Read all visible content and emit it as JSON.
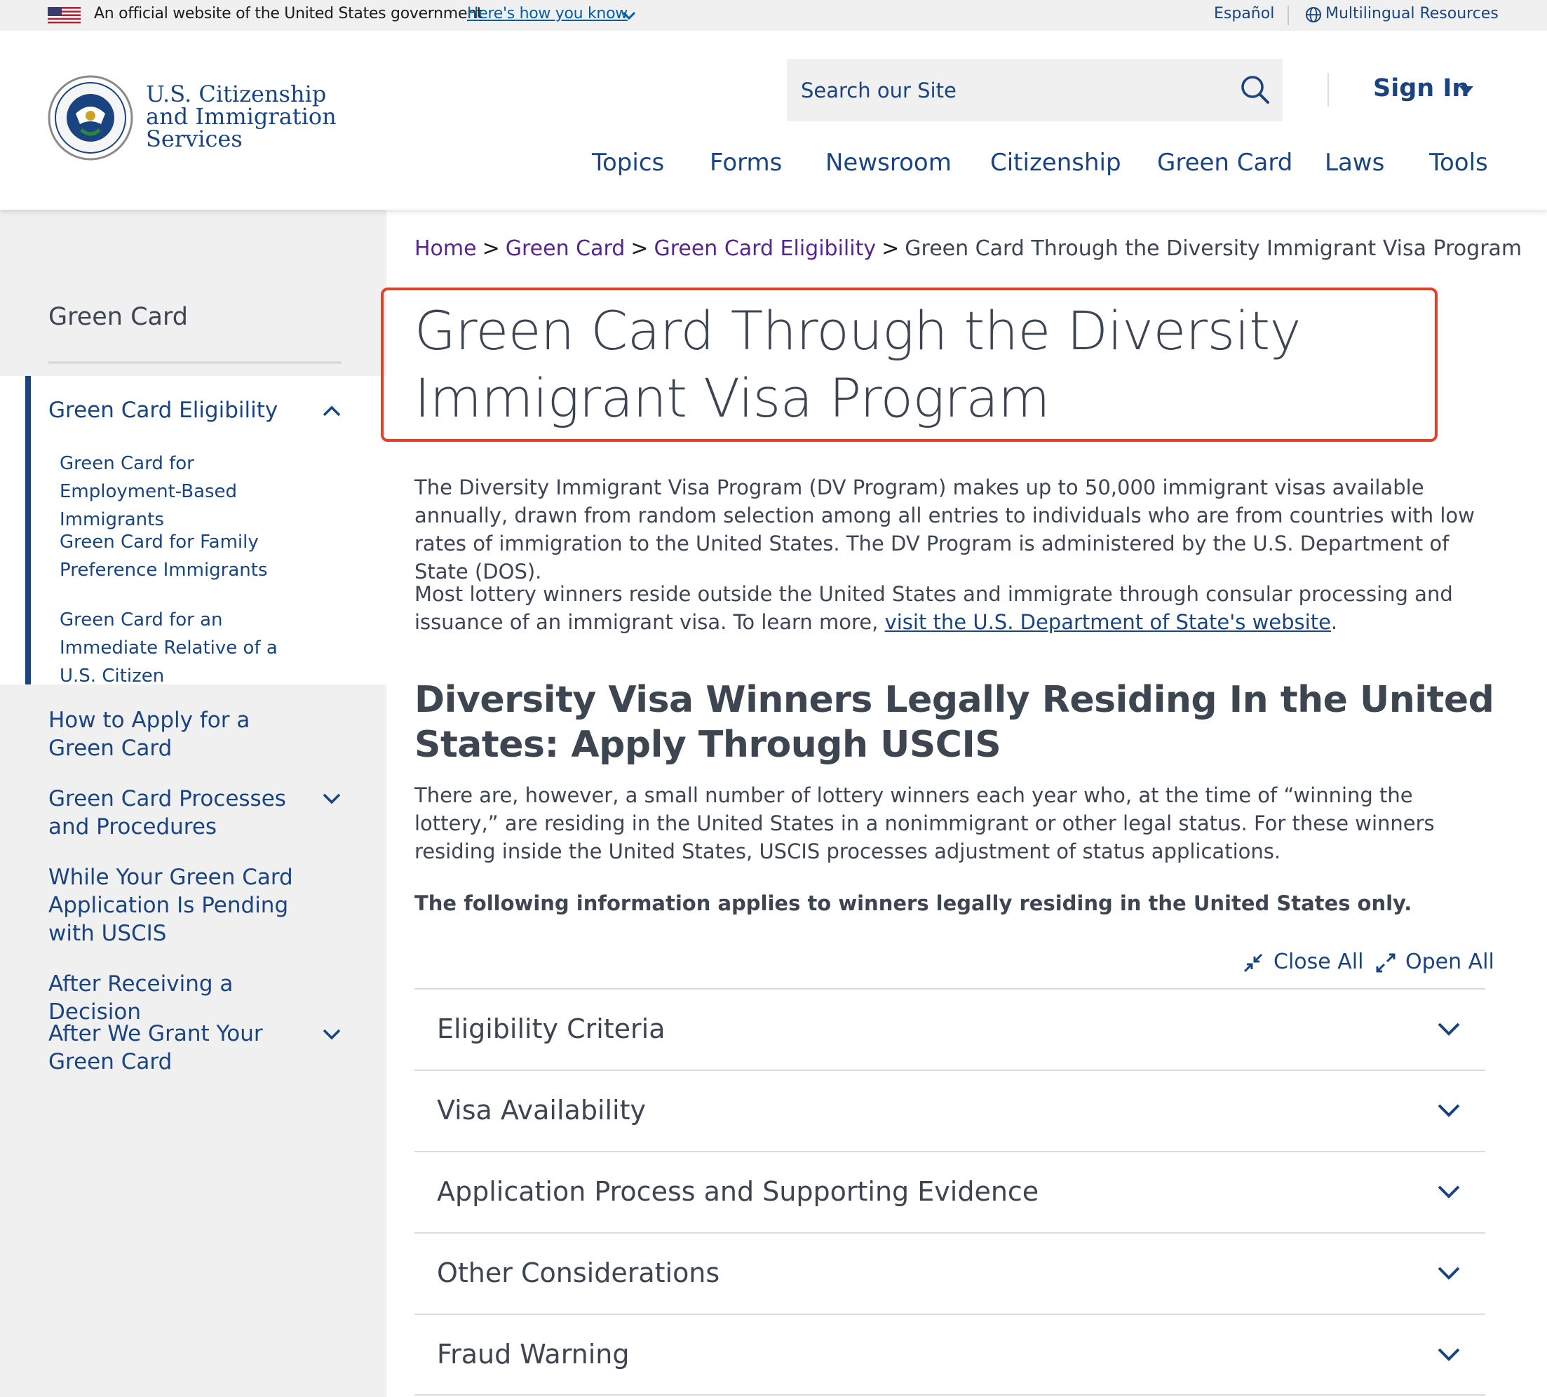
{
  "gov_banner": {
    "official_text": "An official website of the United States government",
    "how_you_know": "Here's how you know",
    "espanol": "Español",
    "multilingual": "Multilingual Resources"
  },
  "header": {
    "logo_line1": "U.S. Citizenship",
    "logo_line2": "and Immigration",
    "logo_line3": "Services",
    "search_placeholder": "Search our Site",
    "sign_in": "Sign In",
    "nav": [
      "Topics",
      "Forms",
      "Newsroom",
      "Citizenship",
      "Green Card",
      "Laws",
      "Tools"
    ]
  },
  "sidebar": {
    "title": "Green Card",
    "active_section": "Green Card Eligibility",
    "sub_items": [
      "Green Card for Employment-Based Immigrants",
      "Green Card for Family Preference Immigrants",
      "Green Card for an Immediate Relative of a U.S. Citizen"
    ],
    "items": [
      "How to Apply for a Green Card",
      "Green Card Processes and Procedures",
      "While Your Green Card Application Is Pending with USCIS",
      "After Receiving a Decision",
      "After We Grant Your Green Card"
    ]
  },
  "breadcrumb": {
    "home": "Home",
    "green_card": "Green Card",
    "eligibility": "Green Card Eligibility",
    "current": "Green Card Through the Diversity Immigrant Visa Program",
    "separator": ">"
  },
  "main": {
    "title": "Green Card Through the Diversity Immigrant Visa Program",
    "para1": "The Diversity Immigrant Visa Program (DV Program) makes up to 50,000 immigrant visas available annually, drawn from random selection among all entries to individuals who are from countries with low rates of immigration to the United States. The DV Program is administered by the U.S. Department of State (DOS).",
    "para2_before": "Most lottery winners reside outside the United States and immigrate through consular processing and issuance of an immigrant visa. To learn more, ",
    "para2_link": "visit the U.S. Department of State's website",
    "para2_after": ".",
    "h2": "Diversity Visa Winners Legally Residing In the United States: Apply Through USCIS",
    "para3": "There are, however, a small number of lottery winners each year who, at the time of “winning the lottery,” are residing in the United States in a nonimmigrant or other legal status. For these winners residing inside the United States, USCIS processes adjustment of status applications.",
    "bold_para": "The following information applies to winners legally residing in the United States only.",
    "close_all": "Close All",
    "open_all": "Open All",
    "accordion": [
      "Eligibility Criteria",
      "Visa Availability",
      "Application Process and Supporting Evidence",
      "Other Considerations",
      "Fraud Warning"
    ]
  }
}
